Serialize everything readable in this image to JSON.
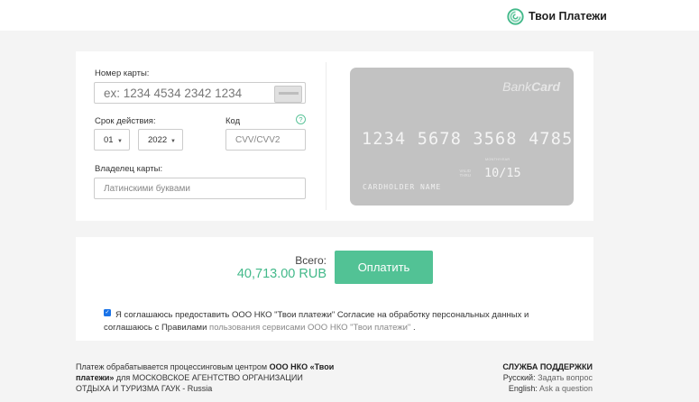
{
  "header": {
    "brand_name": "Твои Платежи",
    "brand_color": "#43b98a"
  },
  "card_form": {
    "card_number_label": "Номер карты:",
    "card_number_placeholder": "ex: 1234 4534 2342 1234",
    "expiry_label": "Срок действия:",
    "expiry_month": "01",
    "expiry_year": "2022",
    "cvv_label": "Код",
    "cvv_help": "?",
    "cvv_placeholder": "CVV/CVV2",
    "holder_label": "Владелец карты:",
    "holder_placeholder": "Латинскими буквами"
  },
  "card_preview": {
    "brand_light": "Bank",
    "brand_bold": "Card",
    "number": "1234 5678 3568 4785",
    "valid_thru": "VALID THRU",
    "month_year": "MONTH/YEAR",
    "expiry": "10/15",
    "holder": "CARDHOLDER NAME"
  },
  "payment": {
    "total_label": "Всего:",
    "total_value": "40,713.00 RUB",
    "pay_button": "Оплатить"
  },
  "consent": {
    "checked": true,
    "text_main": "Я соглашаюсь предоставить ООО НКО \"Твои платежи\" Согласие на обработку персональных данных и соглашаюсь с Правилами",
    "text_link": "пользования сервисами ООО НКО \"Твои платежи\"",
    "text_end": "."
  },
  "footer": {
    "processing_prefix": "Платеж обрабатывается процессинговым центром",
    "processing_org_a": "ООО НКО",
    "processing_org_b": "«Твои платежи»",
    "processing_suffix": "для МОСКОВСКОЕ АГЕНТСТВО ОРГАНИЗАЦИИ ОТДЫХА И ТУРИЗМА ГАУК - Russia",
    "support_title": "СЛУЖБА ПОДДЕРЖКИ",
    "support_ru_label": "Русский:",
    "support_ru_link": "Задать вопрос",
    "support_en_label": "English:",
    "support_en_link": "Ask a question"
  }
}
